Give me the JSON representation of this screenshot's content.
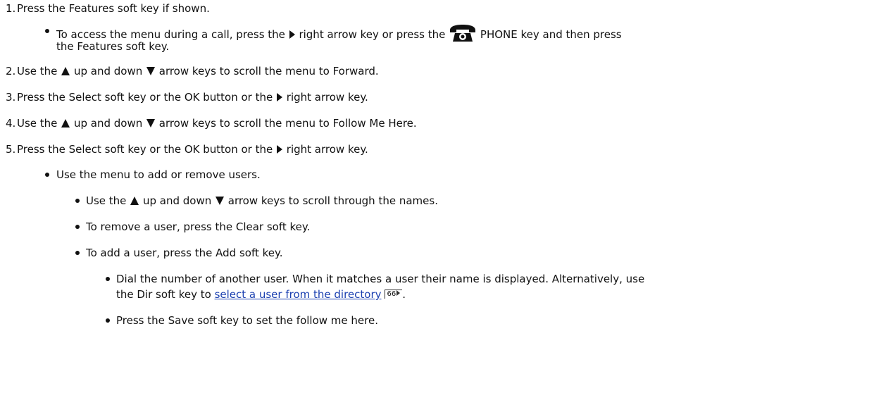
{
  "steps": [
    {
      "num": "1.",
      "text": "Press the Features soft key if shown."
    },
    {
      "num": "2.",
      "a": "Use the ",
      "b": " up and down ",
      "c": " arrow keys to scroll the menu to Forward."
    },
    {
      "num": "3.",
      "a": "Press the Select soft key or the OK button or the ",
      "b": " right arrow key."
    },
    {
      "num": "4.",
      "a": "Use the ",
      "b": " up and down ",
      "c": " arrow keys to scroll the menu to Follow Me Here."
    },
    {
      "num": "5.",
      "a": "Press the Select soft key or the OK button or the ",
      "b": " right arrow key."
    }
  ],
  "sub1": {
    "a": "To access the menu during a call, press the ",
    "b": " right arrow key or press the ",
    "c": " PHONE key and then press",
    "d": "the Features soft key."
  },
  "sub5": {
    "menu": "Use the menu to add or remove users.",
    "scroll_a": "Use the ",
    "scroll_b": " up and down ",
    "scroll_c": " arrow keys to scroll through the names.",
    "remove": "To remove a user, press the Clear soft key.",
    "add": "To add a user, press the Add soft key.",
    "dial_1": "Dial the number of another user. When it matches a user their name is displayed.  Alternatively, use",
    "dial_2a": "the Dir soft key to ",
    "dial_link": "select a user from the directory",
    "dial_pageref": "66",
    "dial_2b": ".",
    "save": "Press the Save soft key to set the follow me here."
  },
  "icons": {
    "right_arrow": "right-arrow-key-icon",
    "up_arrow": "up-arrow-key-icon",
    "down_arrow": "down-arrow-key-icon",
    "phone": "phone-key-icon"
  }
}
